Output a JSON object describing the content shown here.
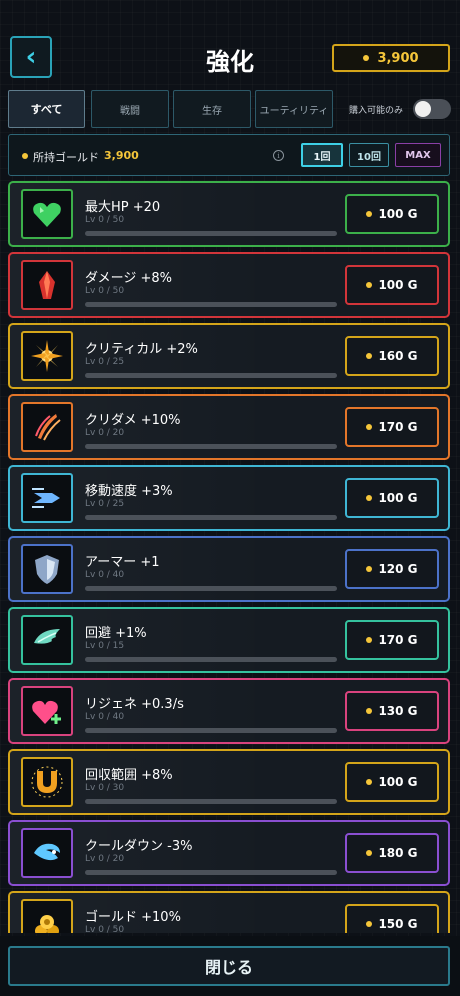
{
  "header": {
    "back_icon": "chevron-left-icon",
    "title": "強化",
    "gold_total": "3,900"
  },
  "tabs": [
    {
      "label": "すべて",
      "active": true
    },
    {
      "label": "戦闘",
      "active": false
    },
    {
      "label": "生存",
      "active": false
    },
    {
      "label": "ユーティリティ",
      "active": false
    }
  ],
  "filter": {
    "label": "購入可能のみ",
    "on": false
  },
  "gold_bar": {
    "label": "所持ゴールド",
    "value": "3,900",
    "info_icon": "i",
    "quantities": [
      "1回",
      "10回",
      "MAX"
    ],
    "selected": "1回"
  },
  "upgrades": [
    {
      "name": "最大HP +20",
      "level": "Lv 0 / 50",
      "progress": 0,
      "cost": "100 G",
      "color": "#3cb04a",
      "icon": "heart-gem-icon"
    },
    {
      "name": "ダメージ +8%",
      "level": "Lv 0 / 50",
      "progress": 0,
      "cost": "100 G",
      "color": "#d2353a",
      "icon": "crystal-icon"
    },
    {
      "name": "クリティカル +2%",
      "level": "Lv 0 / 25",
      "progress": 0,
      "cost": "160 G",
      "color": "#d4a51a",
      "icon": "burst-icon"
    },
    {
      "name": "クリダメ +10%",
      "level": "Lv 0 / 20",
      "progress": 0,
      "cost": "170 G",
      "color": "#e3762a",
      "icon": "claw-icon"
    },
    {
      "name": "移動速度 +3%",
      "level": "Lv 0 / 25",
      "progress": 0,
      "cost": "100 G",
      "color": "#3fb6d4",
      "icon": "speed-icon"
    },
    {
      "name": "アーマー +1",
      "level": "Lv 0 / 40",
      "progress": 0,
      "cost": "120 G",
      "color": "#4c72c9",
      "icon": "shield-icon"
    },
    {
      "name": "回避 +1%",
      "level": "Lv 0 / 15",
      "progress": 0,
      "cost": "170 G",
      "color": "#35c29e",
      "icon": "wing-icon"
    },
    {
      "name": "リジェネ +0.3/s",
      "level": "Lv 0 / 40",
      "progress": 0,
      "cost": "130 G",
      "color": "#d9437e",
      "icon": "heart-plus-icon"
    },
    {
      "name": "回収範囲 +8%",
      "level": "Lv 0 / 30",
      "progress": 0,
      "cost": "100 G",
      "color": "#d4a51a",
      "icon": "magnet-icon"
    },
    {
      "name": "クールダウン -3%",
      "level": "Lv 0 / 20",
      "progress": 0,
      "cost": "180 G",
      "color": "#8a4fd1",
      "icon": "swirl-icon"
    },
    {
      "name": "ゴールド +10%",
      "level": "Lv 0 / 50",
      "progress": 0,
      "cost": "150 G",
      "color": "#d4a51a",
      "icon": "gold-pile-icon"
    }
  ],
  "footer": {
    "close_label": "閉じる"
  }
}
